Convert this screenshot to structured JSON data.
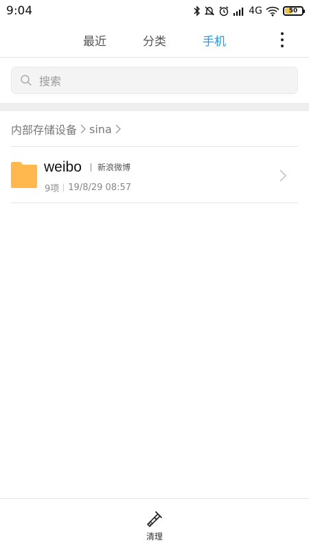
{
  "status_bar": {
    "time": "9:04",
    "network": "4G",
    "battery_level": "50",
    "battery_fraction": 0.5,
    "icons": [
      "bluetooth-icon",
      "notifications-off-icon",
      "alarm-icon",
      "signal-icon",
      "wifi-icon",
      "battery-icon"
    ]
  },
  "tabs": [
    {
      "label": "最近",
      "active": false
    },
    {
      "label": "分类",
      "active": false
    },
    {
      "label": "手机",
      "active": true
    }
  ],
  "search": {
    "placeholder": "搜索"
  },
  "breadcrumb": [
    "内部存储设备",
    "sina"
  ],
  "files": [
    {
      "name": "weibo",
      "tag": "新浪微博",
      "count": "9项",
      "modified": "19/8/29 08:57",
      "icon": "folder-icon"
    }
  ],
  "bottom_bar": {
    "clean_label": "清理"
  },
  "colors": {
    "accent": "#1a9bf0",
    "folder": "#ffb84d",
    "battery": "#f5c33b"
  }
}
